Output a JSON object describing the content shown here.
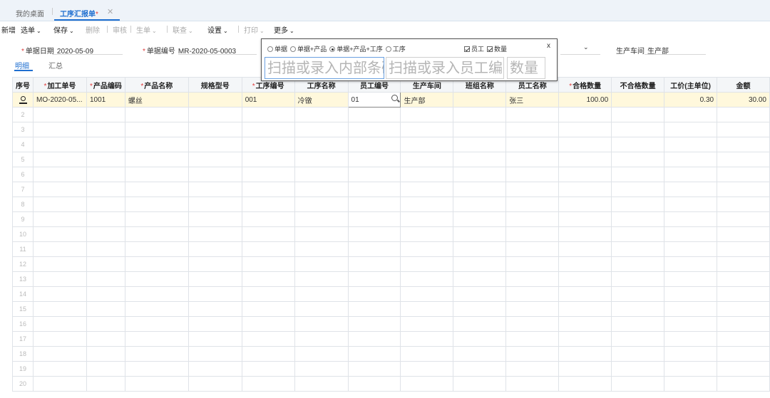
{
  "tabs": {
    "home": "我的桌面",
    "active": "工序汇报单",
    "star": "*",
    "close": "✕"
  },
  "toolbar": {
    "new": "新增",
    "select": "选单",
    "save": "保存",
    "delete": "删除",
    "audit": "审核",
    "generate": "生单",
    "query": "联查",
    "settings": "设置",
    "print": "打印",
    "more": "更多",
    "caret": "⌄"
  },
  "header": {
    "date_label": "单据日期",
    "date_value": "2020-05-09",
    "no_label": "单据编号",
    "no_value": "MR-2020-05-0003",
    "workshop_label": "生产车间",
    "workshop_value": "生产部",
    "req": "*",
    "chevron": "⌄"
  },
  "subtabs": {
    "detail": "明细",
    "summary": "汇总"
  },
  "popup": {
    "options": [
      "单据",
      "单据+产品",
      "单据+产品+工序",
      "工序"
    ],
    "selected_index": 2,
    "checks": [
      "员工",
      "数量"
    ],
    "close": "x",
    "scan_barcode": "扫描或录入内部条码",
    "scan_employee": "扫描或录入员工编号",
    "scan_qty": "数量"
  },
  "grid": {
    "columns": [
      {
        "label": "序号",
        "required": false
      },
      {
        "label": "加工单号",
        "required": true
      },
      {
        "label": "产品编码",
        "required": true
      },
      {
        "label": "产品名称",
        "required": true
      },
      {
        "label": "规格型号",
        "required": false
      },
      {
        "label": "工序编号",
        "required": true
      },
      {
        "label": "工序名称",
        "required": false
      },
      {
        "label": "员工编号",
        "required": false
      },
      {
        "label": "生产车间",
        "required": false
      },
      {
        "label": "班组名称",
        "required": false
      },
      {
        "label": "员工名称",
        "required": false
      },
      {
        "label": "合格数量",
        "required": true
      },
      {
        "label": "不合格数量",
        "required": false
      },
      {
        "label": "工价(主单位)",
        "required": false
      },
      {
        "label": "金额",
        "required": false
      }
    ],
    "row1": {
      "mo": "MO-2020-05...",
      "code": "1001",
      "name": "螺丝",
      "spec": "",
      "proc_no": "001",
      "proc_name": "冷镦",
      "emp_no": "01",
      "workshop": "生产部",
      "team": "",
      "emp_name": "张三",
      "qty": "100.00",
      "bad_qty": "",
      "price": "0.30",
      "amount": "30.00"
    },
    "row_numbers": [
      "2",
      "3",
      "4",
      "5",
      "6",
      "7",
      "8",
      "9",
      "10",
      "11",
      "12",
      "13",
      "14",
      "15",
      "16",
      "17",
      "18",
      "19",
      "20"
    ]
  }
}
